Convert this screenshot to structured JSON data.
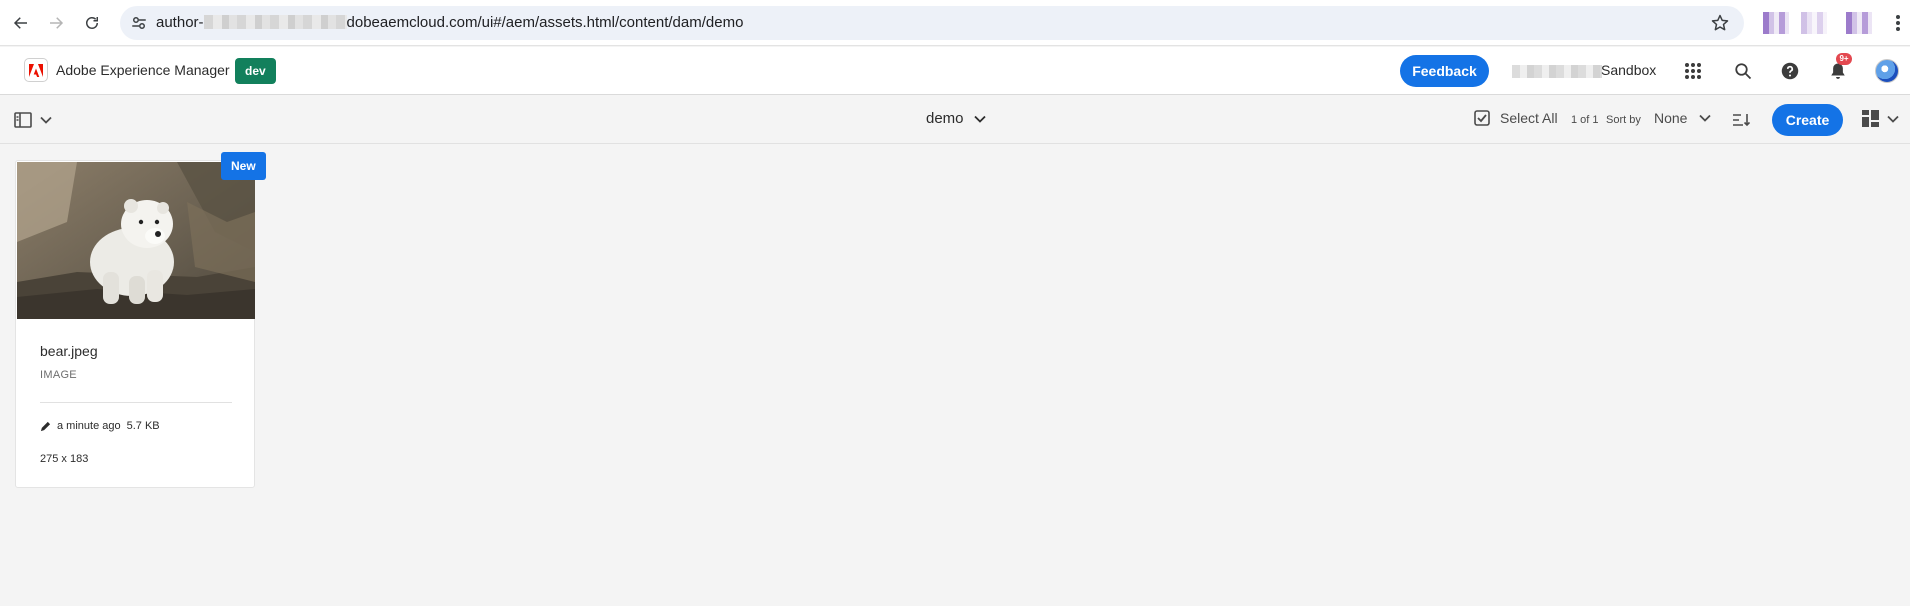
{
  "browser": {
    "url_prefix": "author-",
    "url_rest": "dobeaemcloud.com/ui#/aem/assets.html/content/dam/demo"
  },
  "header": {
    "app_name": "Adobe Experience Manager",
    "env_badge": "dev",
    "feedback_label": "Feedback",
    "org_name": "Sandbox",
    "notification_count": "9+"
  },
  "action_bar": {
    "title": "demo",
    "select_all_label": "Select All",
    "count_text": "1 of 1",
    "sort_by_label": "Sort by",
    "sort_value": "None",
    "create_label": "Create"
  },
  "assets": [
    {
      "badge": "New",
      "title": "bear.jpeg",
      "type": "IMAGE",
      "modified": "a minute ago",
      "size": "5.7 KB",
      "dimensions": "275 x 183"
    }
  ],
  "colors": {
    "accent": "#1473e6",
    "env_badge": "#12805c",
    "notification": "#e34850",
    "background": "#f4f4f4"
  },
  "icons": {
    "back": "arrow-left-icon",
    "forward": "arrow-right-icon",
    "reload": "reload-icon",
    "site_settings": "tune-icon",
    "bookmark": "star-icon",
    "apps": "grid-icon",
    "search": "search-icon",
    "help": "help-icon",
    "notifications": "bell-icon",
    "rail": "rail-toggle-icon",
    "select_all": "checkbox-icon",
    "sort_order": "sort-order-icon",
    "view": "card-view-icon"
  }
}
